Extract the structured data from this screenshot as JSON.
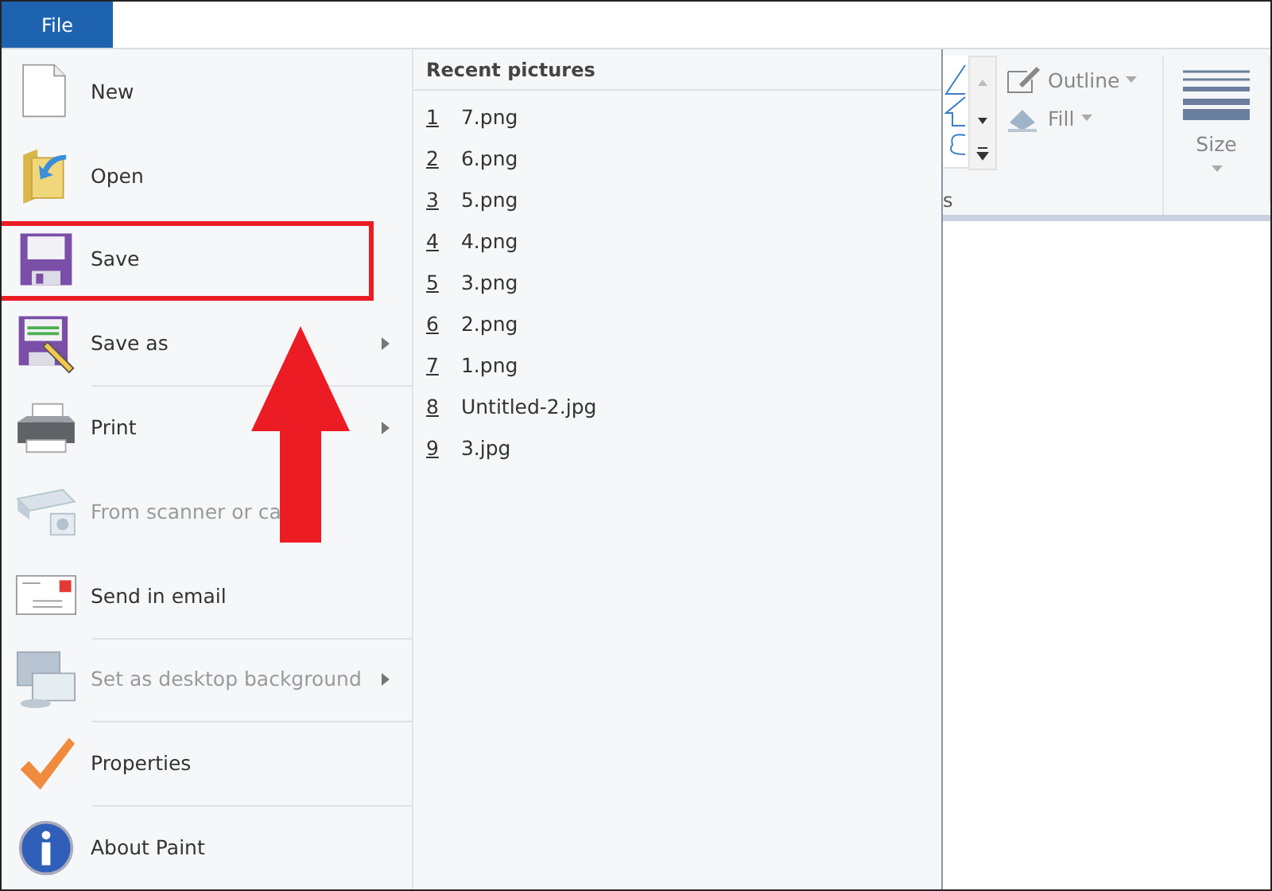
{
  "file_tab": {
    "label": "File",
    "selected": true
  },
  "menu_items": [
    {
      "label": "New",
      "disabled": false,
      "submenu": false,
      "separator_before": false,
      "marked": false
    },
    {
      "label": "Open",
      "disabled": false,
      "submenu": false,
      "separator_before": false,
      "marked": false
    },
    {
      "label": "Save",
      "disabled": false,
      "submenu": false,
      "separator_before": false,
      "marked": true
    },
    {
      "label": "Save as",
      "disabled": false,
      "submenu": true,
      "separator_before": false,
      "marked": false
    },
    {
      "label": "Print",
      "disabled": false,
      "submenu": true,
      "separator_before": true,
      "marked": false
    },
    {
      "label": "From scanner or ca",
      "disabled": true,
      "submenu": false,
      "separator_before": false,
      "marked": false
    },
    {
      "label": "Send in email",
      "disabled": false,
      "submenu": false,
      "separator_before": false,
      "marked": false
    },
    {
      "label": "Set as desktop background",
      "disabled": true,
      "submenu": true,
      "separator_before": true,
      "marked": false
    },
    {
      "label": "Properties",
      "disabled": false,
      "submenu": false,
      "separator_before": true,
      "marked": false
    },
    {
      "label": "About Paint",
      "disabled": false,
      "submenu": false,
      "separator_before": true,
      "marked": false
    }
  ],
  "recent": {
    "title": "Recent pictures",
    "items": [
      {
        "number": "1",
        "name": "7.png"
      },
      {
        "number": "2",
        "name": "6.png"
      },
      {
        "number": "3",
        "name": "5.png"
      },
      {
        "number": "4",
        "name": "4.png"
      },
      {
        "number": "5",
        "name": "3.png"
      },
      {
        "number": "6",
        "name": "2.png"
      },
      {
        "number": "7",
        "name": "1.png"
      },
      {
        "number": "8",
        "name": "Untitled-2.jpg"
      },
      {
        "number": "9",
        "name": "3.jpg"
      }
    ]
  },
  "ribbon": {
    "shapes_group_label": "s",
    "outline": "Outline",
    "fill": "Fill",
    "size": "Size"
  },
  "annotations": [
    {
      "kind": "arrow"
    }
  ]
}
